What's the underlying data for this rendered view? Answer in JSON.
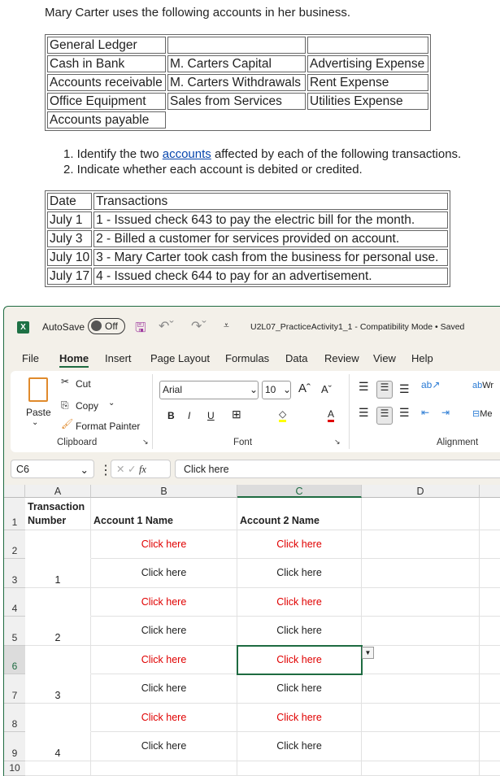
{
  "intro": "Mary Carter uses the following accounts in her business.",
  "accounts_table": [
    [
      "General Ledger",
      "",
      ""
    ],
    [
      "Cash in Bank",
      "M. Carters Capital",
      "Advertising Expense"
    ],
    [
      "Accounts receivable",
      "M. Carters Withdrawals",
      "Rent Expense"
    ],
    [
      "Office Equipment",
      "Sales from Services",
      "Utilities Expense"
    ],
    [
      "Accounts payable"
    ]
  ],
  "instructions": {
    "item1_pre": "1. Identify the two ",
    "item1_link": "accounts",
    "item1_post": " affected by each of the following transactions.",
    "item2": "2. Indicate whether each account is debited or credited."
  },
  "transactions_table": {
    "headers": [
      "Date",
      "Transactions"
    ],
    "rows": [
      [
        "July 1",
        "1 - Issued check 643 to pay the electric bill for the month."
      ],
      [
        "July 3",
        "2 - Billed a customer for services provided on account."
      ],
      [
        "July 10",
        "3 - Mary Carter took cash from the business for personal use."
      ],
      [
        "July 17",
        "4 - Issued check 644 to pay for an advertisement."
      ]
    ]
  },
  "excel": {
    "autosave": "AutoSave",
    "autosave_state": "Off",
    "title": "U2L07_PracticeActivity1_1  -  Compatibility Mode  •  Saved",
    "tabs": [
      "File",
      "Home",
      "Insert",
      "Page Layout",
      "Formulas",
      "Data",
      "Review",
      "View",
      "Help"
    ],
    "clipboard": {
      "paste": "Paste",
      "cut": "Cut",
      "copy": "Copy",
      "format_painter": "Format Painter",
      "group": "Clipboard"
    },
    "font": {
      "name": "Arial",
      "size": "10",
      "bold": "B",
      "italic": "I",
      "underline": "U",
      "group": "Font"
    },
    "alignment": {
      "wrap": "Wr",
      "merge": "Me",
      "group": "Alignment"
    },
    "name_box": "C6",
    "fx": "fx",
    "formula": "Click here",
    "columns": [
      "A",
      "B",
      "C",
      "D"
    ],
    "rows": [
      "1",
      "2",
      "3",
      "4",
      "5",
      "6",
      "7",
      "8",
      "9",
      "10"
    ],
    "header": {
      "a": "Transaction Number",
      "b": "Account 1 Name",
      "c": "Account 2 Name"
    },
    "cell_text": "Click here",
    "numbers": [
      "1",
      "2",
      "3",
      "4"
    ],
    "colors": {
      "accent": "#1e6b41",
      "red": "#e00000"
    }
  }
}
